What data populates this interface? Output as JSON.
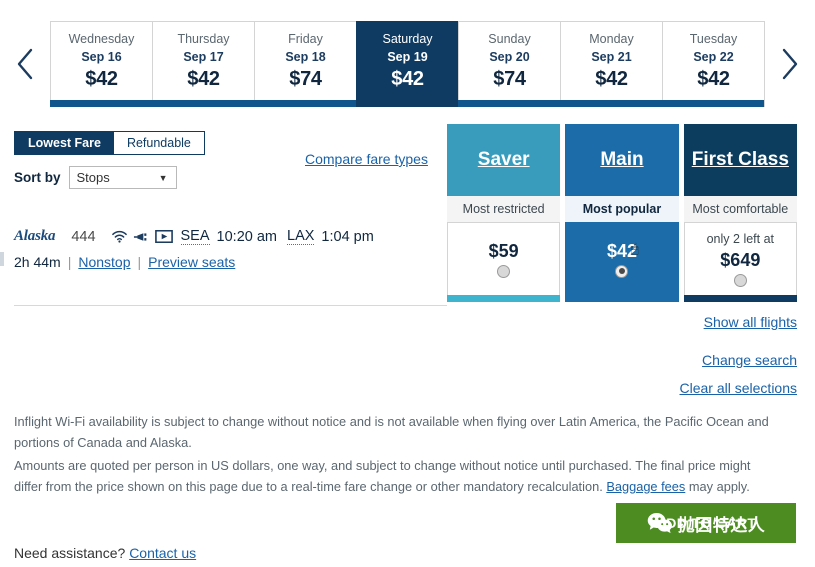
{
  "datestrip": {
    "prev_arrow": "chevron-left",
    "next_arrow": "chevron-right",
    "days": [
      {
        "dow": "Wednesday",
        "date": "Sep 16",
        "price": "$42",
        "selected": false
      },
      {
        "dow": "Thursday",
        "date": "Sep 17",
        "price": "$42",
        "selected": false
      },
      {
        "dow": "Friday",
        "date": "Sep 18",
        "price": "$74",
        "selected": false
      },
      {
        "dow": "Saturday",
        "date": "Sep 19",
        "price": "$42",
        "selected": true
      },
      {
        "dow": "Sunday",
        "date": "Sep 20",
        "price": "$74",
        "selected": false
      },
      {
        "dow": "Monday",
        "date": "Sep 21",
        "price": "$42",
        "selected": false
      },
      {
        "dow": "Tuesday",
        "date": "Sep 22",
        "price": "$42",
        "selected": false
      }
    ]
  },
  "controls": {
    "toggle": {
      "lowest_fare": "Lowest Fare",
      "refundable": "Refundable",
      "active": "Lowest Fare"
    },
    "sort": {
      "label": "Sort by",
      "value": "Stops",
      "caret": "▼"
    },
    "compare_link": "Compare fare types"
  },
  "fares": {
    "columns": [
      {
        "name": "Saver",
        "subtitle": "Most restricted",
        "price": "$59",
        "note": "",
        "selected": false,
        "header_color": "#3a9cbd",
        "accent_color": "#3fb4cf"
      },
      {
        "name": "Main",
        "subtitle": "Most popular",
        "price": "$42",
        "note": "",
        "selected": true,
        "header_color": "#1b6ca8",
        "accent_color": "#1b6ca8"
      },
      {
        "name": "First Class",
        "subtitle": "Most comfortable",
        "price": "$649",
        "note": "only 2 left at",
        "selected": false,
        "header_color": "#0c3d5e",
        "accent_color": "#0f3b62"
      }
    ]
  },
  "flight": {
    "airline": "Alaska",
    "flight_number": "444",
    "amenities": [
      "wifi-icon",
      "power-outlet-icon",
      "entertainment-screen-icon"
    ],
    "origin": "SEA",
    "depart_time": "10:20 am",
    "destination": "LAX",
    "arrive_time": "1:04 pm",
    "duration": "2h 44m",
    "stops": "Nonstop",
    "preview_seats": "Preview seats",
    "separator": "|"
  },
  "right_links": {
    "show_all": "Show all flights",
    "change_search": "Change search",
    "clear_all": "Clear all selections"
  },
  "disclaimers": {
    "wifi": "Inflight Wi-Fi availability is subject to change without notice and is not available when flying over Latin America, the Pacific Ocean and portions of Canada and Alaska.",
    "pricing_before": "Amounts are quoted per person in US dollars, one way, and subject to change without notice until purchased. The final price might differ from the price shown on this page due to a real-time fare change or other mandatory recalculation. ",
    "baggage_link": "Baggage fees",
    "pricing_after": " may apply."
  },
  "cart": {
    "label": "ADD TO CART",
    "color": "#4c8c20"
  },
  "watermark": {
    "text": "抛因特达人",
    "logo": "wechat-icon"
  },
  "footer": {
    "question": "Need assistance? ",
    "contact_link": "Contact us"
  }
}
